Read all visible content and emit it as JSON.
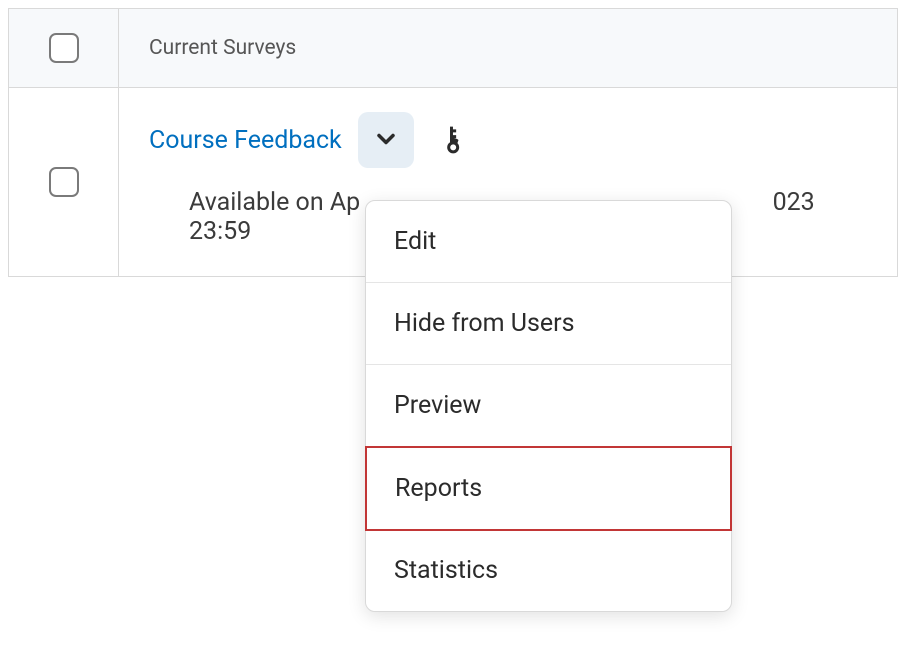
{
  "header": {
    "column_label": "Current Surveys"
  },
  "survey": {
    "name": "Course Feedback",
    "availability_prefix": "Available on Ap",
    "availability_suffix": "023 23:59"
  },
  "menu": {
    "items": [
      {
        "label": "Edit",
        "highlighted": false
      },
      {
        "label": "Hide from Users",
        "highlighted": false
      },
      {
        "label": "Preview",
        "highlighted": false
      },
      {
        "label": "Reports",
        "highlighted": true
      },
      {
        "label": "Statistics",
        "highlighted": false
      }
    ]
  }
}
